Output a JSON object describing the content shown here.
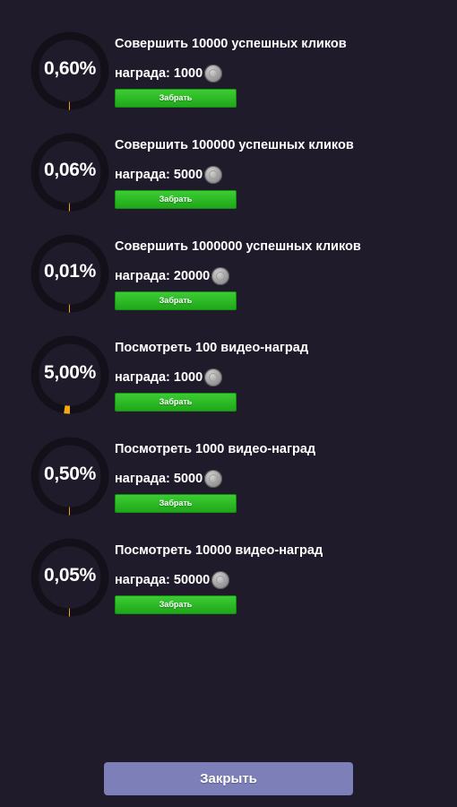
{
  "tasks": [
    {
      "percent": "0,60%",
      "progress": 0.006,
      "title": "Совершить 10000 успешных кликов",
      "reward": "награда: 1000",
      "coin_icon": "coin-icon",
      "claim_label": "Забрать"
    },
    {
      "percent": "0,06%",
      "progress": 0.0006,
      "title": "Совершить 100000 успешных кликов",
      "reward": "награда: 5000",
      "coin_icon": "coin-icon",
      "claim_label": "Забрать"
    },
    {
      "percent": "0,01%",
      "progress": 0.0001,
      "title": "Совершить 1000000 успешных кликов",
      "reward": "награда: 20000",
      "coin_icon": "coin-icon",
      "claim_label": "Забрать"
    },
    {
      "percent": "5,00%",
      "progress": 0.05,
      "title": "Посмотреть 100 видео-наград",
      "reward": "награда: 1000",
      "coin_icon": "coin-icon",
      "claim_label": "Забрать"
    },
    {
      "percent": "0,50%",
      "progress": 0.005,
      "title": "Посмотреть 1000 видео-наград",
      "reward": "награда: 5000",
      "coin_icon": "coin-icon",
      "claim_label": "Забрать"
    },
    {
      "percent": "0,05%",
      "progress": 0.0005,
      "title": "Посмотреть 10000 видео-наград",
      "reward": "награда: 50000",
      "coin_icon": "coin-icon",
      "claim_label": "Забрать"
    }
  ],
  "close_label": "Закрыть",
  "colors": {
    "background": "#201b2b",
    "ring_track": "#141019",
    "ring_progress": "#f3a916",
    "claim_button": "#2bbb25",
    "close_button": "#7c7fb8"
  }
}
